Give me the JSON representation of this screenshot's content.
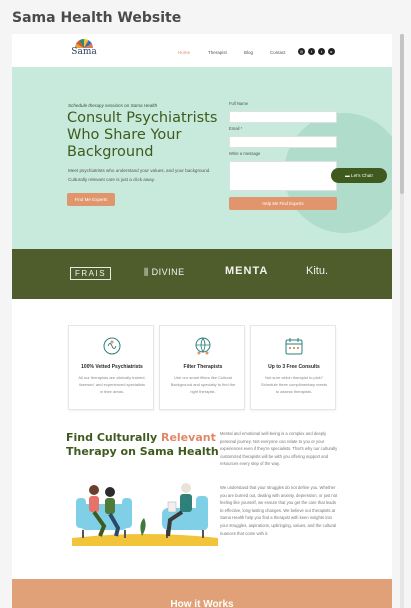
{
  "window": {
    "title": "Sama Health Website"
  },
  "logo": {
    "name": "Sama"
  },
  "nav": {
    "links": [
      "Home",
      "Therapist",
      "Blog",
      "Contact"
    ],
    "socials": [
      "instagram-icon",
      "facebook-icon",
      "twitter-icon",
      "youtube-icon"
    ]
  },
  "hero": {
    "kicker": "Schedule therapy sessions on Sama Health",
    "title": "Consult Psychiatrists Who Share Your Background",
    "description": "Meet psychiatrists who understand your values, and your background. Culturally relevant care is just a click away.",
    "cta": "Find Me Experts"
  },
  "form": {
    "full_name_label": "Full Name",
    "email_label": "Email *",
    "message_label": "Write a message",
    "submit": "Help Me Find Experts"
  },
  "chat": {
    "label": "Let's Chat!"
  },
  "partners": [
    "FRAIS",
    "DIVINE",
    "MENTA",
    "Kitu."
  ],
  "features": [
    {
      "icon": "brain-icon",
      "title": "100% Vetted Psychiatrists",
      "desc": "All our therapists are clinically trained, licensed, and experienced specialists in their areas."
    },
    {
      "icon": "globe-people-icon",
      "title": "Filter Therapists",
      "desc": "Use our smart filters like Cultural Background and specialty to find the right therapist."
    },
    {
      "icon": "calendar-icon",
      "title": "Up to 3 Free Consults",
      "desc": "Not sure which therapist to pick? Schedule three complimentary meets to assess therapists."
    }
  ],
  "section": {
    "title_part1": "Find Culturally ",
    "title_highlight": "Relevant",
    "title_part2": "Therapy on Sama Health",
    "para1": "Mental and emotional well-being is a complex and deeply personal journey. Not everyone can relate to you or your experiences even if they're specialists. That's why our culturally customized therapists will be with you offering support and resources every step of the way.",
    "para2": "We understand that your struggles do not define you. Whether you are burned out, dealing with anxiety, depression, or just not feeling like yourself, we ensure that you get the care that leads to effective, long-lasting changes. We believe our therapists at Sama Health help you find a therapist with keen insights into your struggles, aspirations, upbringing, values, and the cultural nuances that come with it."
  },
  "footer_band": {
    "title": "How it Works"
  }
}
